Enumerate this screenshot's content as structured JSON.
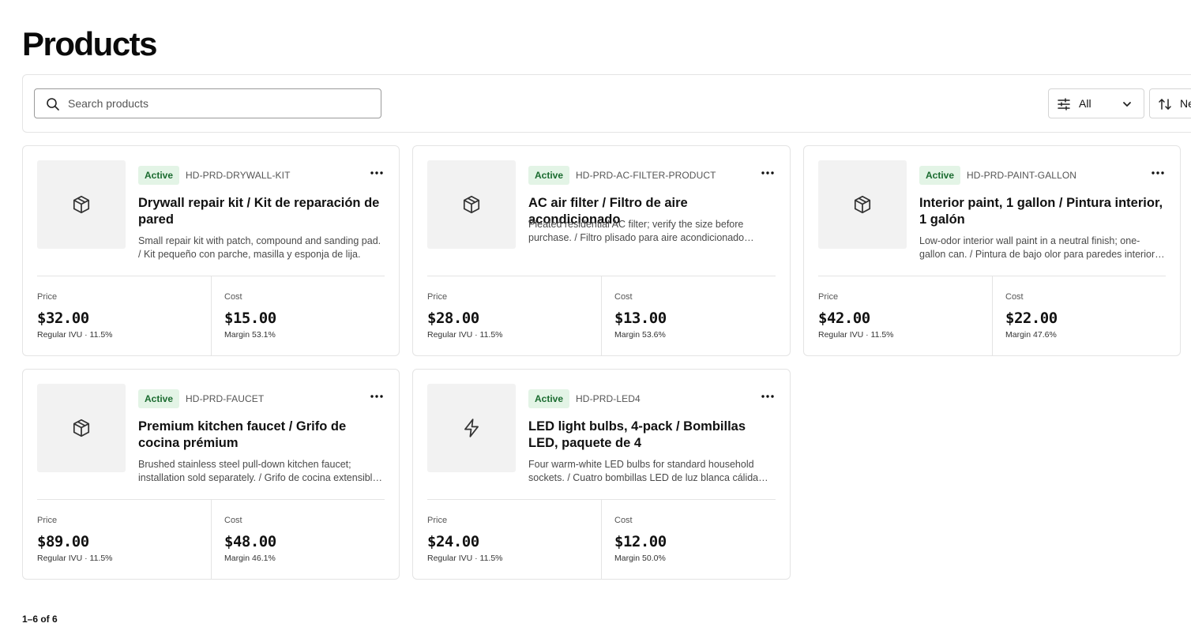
{
  "page": {
    "title": "Products"
  },
  "toolbar": {
    "search_placeholder": "Search products",
    "filter_label": "All",
    "sort_label": "Newest"
  },
  "products": [
    {
      "status": "Active",
      "sku": "HD-PRD-DRYWALL-KIT",
      "name": "Drywall repair kit / Kit de reparación de pared",
      "description": "Small repair kit with patch, compound and sanding pad. / Kit pequeño con parche, masilla y esponja de lija.",
      "icon": "box-icon",
      "price_label": "Price",
      "price": "$32.00",
      "price_sub": "Regular IVU · 11.5%",
      "cost_label": "Cost",
      "cost": "$15.00",
      "cost_sub": "Margin 53.1%"
    },
    {
      "status": "Active",
      "sku": "HD-PRD-AC-FILTER-PRODUCT",
      "name": "AC air filter / Filtro de aire acondicionado",
      "description": "Pleated residential AC filter; verify the size before purchase. / Filtro plisado para aire acondicionado residencial; verifique el tamaño antes de comprar.",
      "icon": "box-icon",
      "price_label": "Price",
      "price": "$28.00",
      "price_sub": "Regular IVU · 11.5%",
      "cost_label": "Cost",
      "cost": "$13.00",
      "cost_sub": "Margin 53.6%"
    },
    {
      "status": "Active",
      "sku": "HD-PRD-PAINT-GALLON",
      "name": "Interior paint, 1 gallon / Pintura interior, 1 galón",
      "description": "Low-odor interior wall paint in a neutral finish; one-gallon can. / Pintura de bajo olor para paredes interiores en acabado neutro; lata de un galón.",
      "icon": "box-icon",
      "price_label": "Price",
      "price": "$42.00",
      "price_sub": "Regular IVU · 11.5%",
      "cost_label": "Cost",
      "cost": "$22.00",
      "cost_sub": "Margin 47.6%"
    },
    {
      "status": "Active",
      "sku": "HD-PRD-FAUCET",
      "name": "Premium kitchen faucet / Grifo de cocina prémium",
      "description": "Brushed stainless steel pull-down kitchen faucet; installation sold separately. / Grifo de cocina extensible de acero inoxidable cepillado; instalación se vende por separado.",
      "icon": "box-icon",
      "price_label": "Price",
      "price": "$89.00",
      "price_sub": "Regular IVU · 11.5%",
      "cost_label": "Cost",
      "cost": "$48.00",
      "cost_sub": "Margin 46.1%"
    },
    {
      "status": "Active",
      "sku": "HD-PRD-LED4",
      "name": "LED light bulbs, 4-pack / Bombillas LED, paquete de 4",
      "description": "Four warm-white LED bulbs for standard household sockets. / Cuatro bombillas LED de luz blanca cálida para portalámparas estándar.",
      "icon": "lightning-icon",
      "price_label": "Price",
      "price": "$24.00",
      "price_sub": "Regular IVU · 11.5%",
      "cost_label": "Cost",
      "cost": "$12.00",
      "cost_sub": "Margin 50.0%"
    }
  ],
  "pagination": {
    "range": "1–6 of 6"
  },
  "colors": {
    "badge_bg": "#e3f4e6",
    "badge_text": "#1a6b2f",
    "thumb_bg": "#f2f2f2",
    "border": "#e4e4e4"
  }
}
